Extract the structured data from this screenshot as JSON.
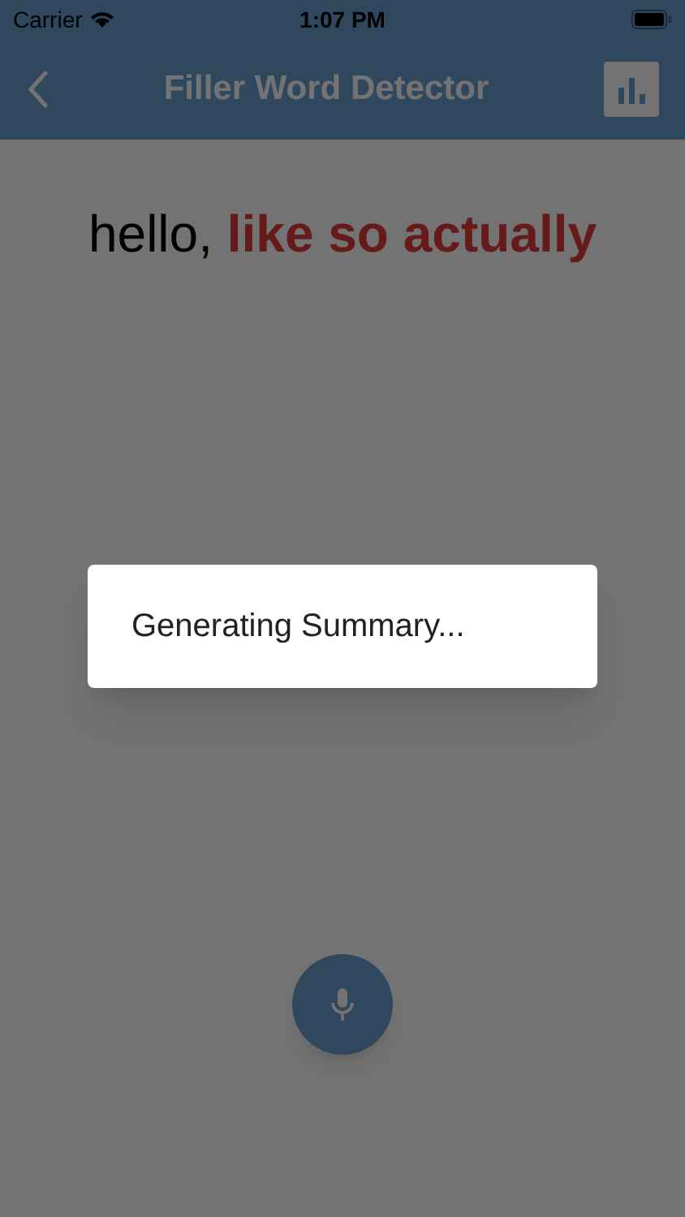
{
  "status_bar": {
    "carrier": "Carrier",
    "time": "1:07 PM"
  },
  "app_bar": {
    "title": "Filler Word Detector"
  },
  "transcript": "hello, **like so actually**",
  "dialog": {
    "message": "Generating Summary..."
  }
}
